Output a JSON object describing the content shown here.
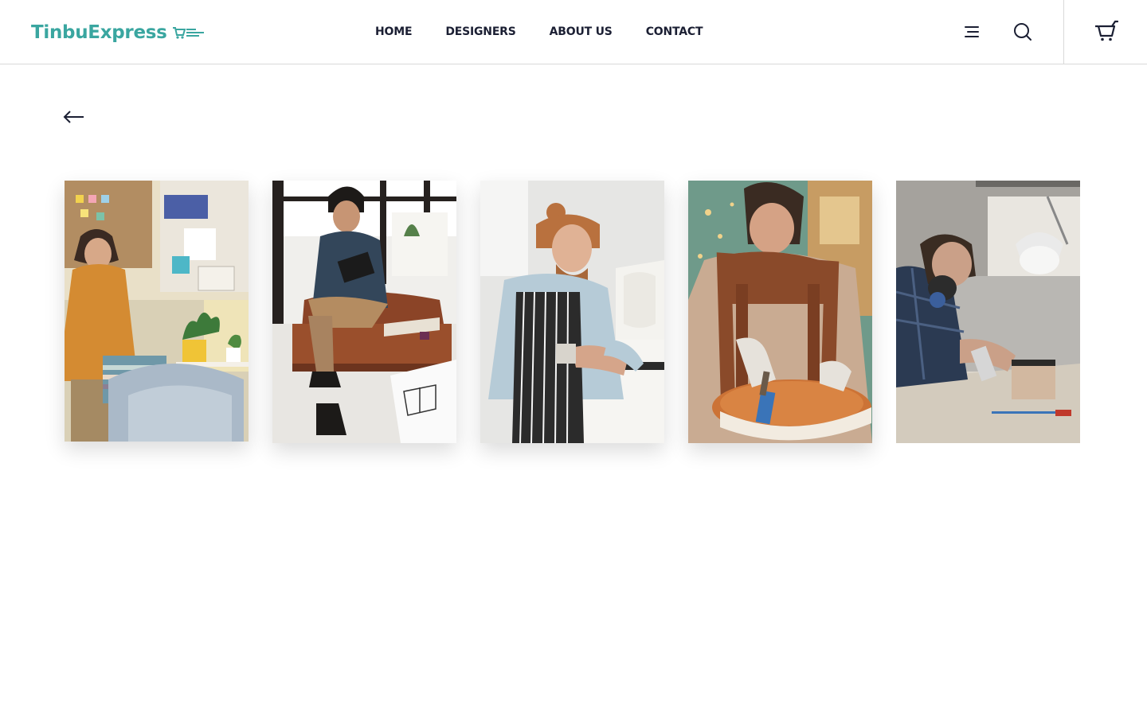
{
  "brand": {
    "name": "TinbuExpress",
    "accent_color": "#3aa6a0",
    "logo_icon": "speeding-cart-icon"
  },
  "nav": {
    "items": [
      {
        "label": "HOME"
      },
      {
        "label": "DESIGNERS"
      },
      {
        "label": "ABOUT US"
      },
      {
        "label": "CONTACT"
      }
    ]
  },
  "header_icons": {
    "menu": "menu-icon",
    "search": "search-icon",
    "cart": "cart-icon"
  },
  "back": {
    "icon": "arrow-left-icon"
  },
  "gallery": {
    "photos": [
      {
        "subject": "designer-with-fabric-swatches"
      },
      {
        "subject": "designer-on-leather-sofa-with-tablet"
      },
      {
        "subject": "carpenter-with-man-bun-working-on-furniture"
      },
      {
        "subject": "woman-painting-wooden-chair"
      },
      {
        "subject": "craftsman-with-respirator-spray-painting"
      }
    ]
  }
}
